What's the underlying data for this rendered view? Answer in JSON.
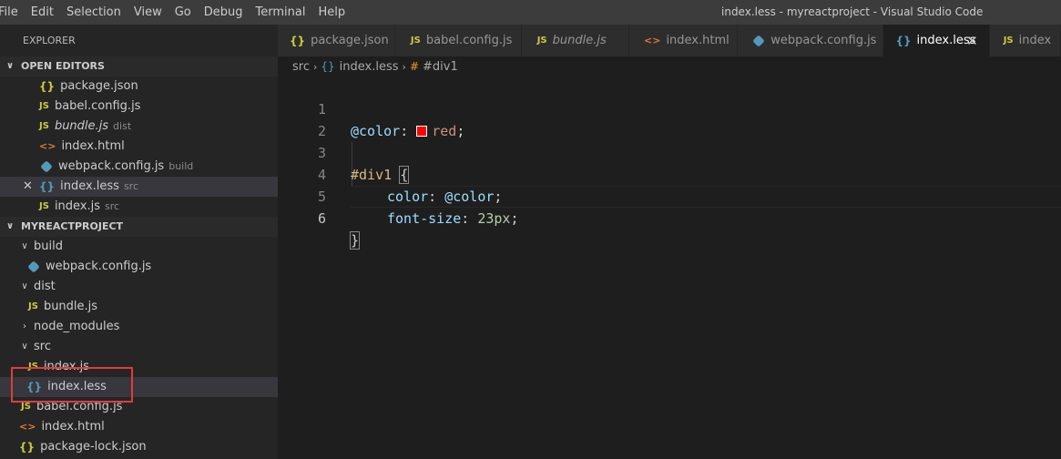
{
  "menu": [
    "File",
    "Edit",
    "Selection",
    "View",
    "Go",
    "Debug",
    "Terminal",
    "Help"
  ],
  "window_title": "index.less - myreactproject - Visual Studio Code",
  "sidebar": {
    "title": "EXPLORER",
    "open_editors": {
      "header": "OPEN EDITORS",
      "items": [
        {
          "icon": "{}",
          "name": "package.json",
          "desc": ""
        },
        {
          "icon": "JS",
          "name": "babel.config.js",
          "desc": ""
        },
        {
          "icon": "JS",
          "name": "bundle.js",
          "desc": "dist"
        },
        {
          "icon": "<>",
          "name": "index.html",
          "desc": ""
        },
        {
          "icon": "webpack",
          "name": "webpack.config.js",
          "desc": "build"
        },
        {
          "icon": "{}",
          "name": "index.less",
          "desc": "src",
          "close": "✕"
        },
        {
          "icon": "JS",
          "name": "index.js",
          "desc": "src"
        }
      ]
    },
    "project": {
      "header": "MYREACTPROJECT",
      "items": [
        {
          "type": "folder",
          "name": "build",
          "chev": "∨"
        },
        {
          "type": "file",
          "icon": "webpack",
          "name": "webpack.config.js"
        },
        {
          "type": "folder",
          "name": "dist",
          "chev": "∨"
        },
        {
          "type": "file",
          "icon": "JS",
          "name": "bundle.js"
        },
        {
          "type": "folder",
          "name": "node_modules",
          "chev": "›"
        },
        {
          "type": "folder",
          "name": "src",
          "chev": "∨"
        },
        {
          "type": "file",
          "icon": "JS",
          "name": "index.js"
        },
        {
          "type": "file",
          "icon": "{}",
          "name": "index.less"
        },
        {
          "type": "file",
          "icon": "JS",
          "name": "babel.config.js"
        },
        {
          "type": "file",
          "icon": "<>",
          "name": "index.html"
        },
        {
          "type": "file",
          "icon": "{}",
          "name": "package-lock.json"
        }
      ]
    }
  },
  "tabs": [
    {
      "icon": "{}",
      "label": "package.json"
    },
    {
      "icon": "JS",
      "label": "babel.config.js"
    },
    {
      "icon": "JS",
      "label": "bundle.js"
    },
    {
      "icon": "<>",
      "label": "index.html"
    },
    {
      "icon": "webpack",
      "label": "webpack.config.js"
    },
    {
      "icon": "{}",
      "label": "index.less",
      "close": "✕"
    },
    {
      "icon": "JS",
      "label": "index"
    }
  ],
  "breadcrumb": {
    "folder": "src",
    "sep": "›",
    "file_icon": "{}",
    "file": "index.less",
    "symbol_icon": "#",
    "symbol": "#div1"
  },
  "editor": {
    "line_numbers": [
      "1",
      "2",
      "3",
      "4",
      "5",
      "6"
    ],
    "l1": {
      "var": "@color",
      "colon": ": ",
      "value": "red",
      "semi": ";"
    },
    "l3": {
      "selector": "#div1",
      "space": " ",
      "brace": "{"
    },
    "l4": {
      "prop": "color",
      "colon": ": ",
      "value": "@color",
      "semi": ";"
    },
    "l5": {
      "prop": "font-size",
      "colon": ": ",
      "num": "23px",
      "semi": ";"
    },
    "l6": {
      "brace": "}"
    },
    "swatch_color": "#ff0000"
  },
  "colors": {
    "accent_js": "#cbcb41",
    "accent_less": "#519aba",
    "accent_html": "#e37933",
    "highlight_box": "#e03c3c"
  }
}
